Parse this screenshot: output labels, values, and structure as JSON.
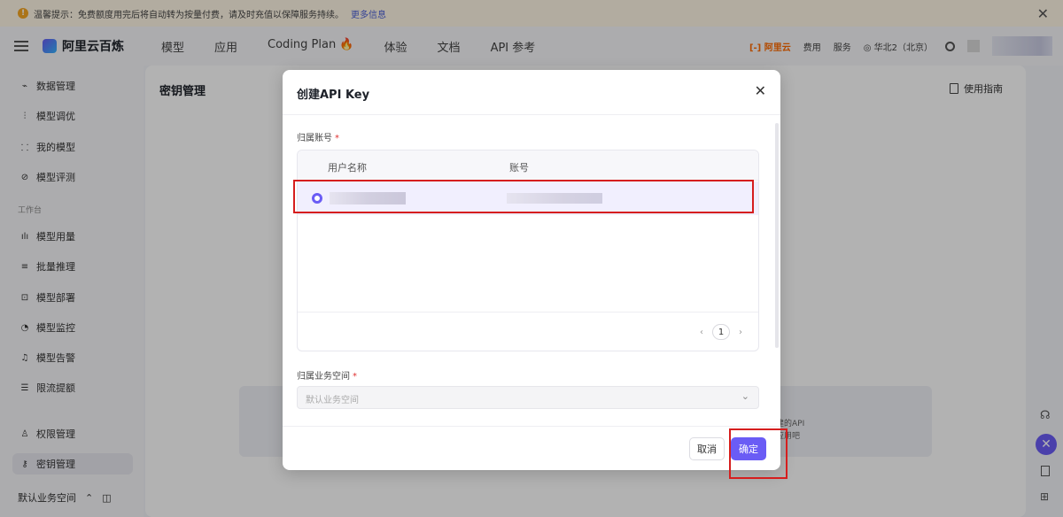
{
  "notice": {
    "text": "温馨提示：免费额度用完后将自动转为按量付费，请及时充值以保障服务持续。",
    "more": "更多信息"
  },
  "topnav": {
    "brand": "阿里云百炼",
    "menu": [
      "模型",
      "应用",
      "Coding Plan 🔥",
      "体验",
      "文档",
      "API 参考"
    ],
    "aliyun": "[-] 阿里云",
    "links": [
      "费用",
      "服务"
    ],
    "region": "华北2（北京）"
  },
  "sidebar": {
    "items_top": [
      {
        "label": "数据管理",
        "icon": "chart-icon"
      },
      {
        "label": "模型调优",
        "icon": "sliders-icon"
      },
      {
        "label": "我的模型",
        "icon": "grid-icon"
      },
      {
        "label": "模型评测",
        "icon": "compass-icon"
      }
    ],
    "group_label": "工作台",
    "items_work": [
      {
        "label": "模型用量",
        "icon": "bar-chart-icon"
      },
      {
        "label": "批量推理",
        "icon": "list-icon"
      },
      {
        "label": "模型部署",
        "icon": "deploy-icon"
      },
      {
        "label": "模型监控",
        "icon": "monitor-icon"
      },
      {
        "label": "模型告警",
        "icon": "bell-icon"
      },
      {
        "label": "限流提额",
        "icon": "database-icon"
      }
    ],
    "items_bottom": [
      {
        "label": "权限管理",
        "icon": "user-icon"
      },
      {
        "label": "密钥管理",
        "icon": "key-icon"
      }
    ],
    "workspace": "默认业务空间"
  },
  "main": {
    "title": "密钥管理",
    "guide": "使用指南",
    "empty_line1": "建的API",
    "empty_line2": "应用吧"
  },
  "modal": {
    "title": "创建API Key",
    "account_label": "归属账号",
    "required_mark": "*",
    "columns": [
      "用户名称",
      "账号"
    ],
    "page": "1",
    "workspace_label": "归属业务空间",
    "workspace_placeholder": "默认业务空间",
    "cancel": "取消",
    "confirm": "确定"
  },
  "colors": {
    "accent": "#6a5cf5",
    "highlight": "#d61e1e"
  }
}
